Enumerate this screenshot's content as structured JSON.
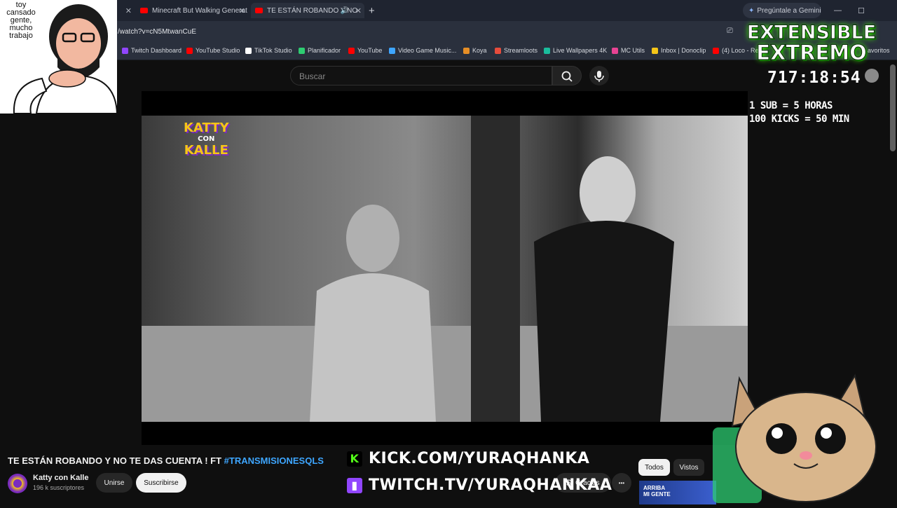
{
  "browser": {
    "tabs": [
      {
        "title": "Minecraft But Walking Generat",
        "close": "✕"
      },
      {
        "title": "TE ESTÁN ROBANDO Y NO",
        "close": "✕"
      }
    ],
    "first_tab_close": "✕",
    "new_tab": "+",
    "gemini_button": "Pregúntale a Gemini",
    "address": "/watch?v=cN5MtwanCuE",
    "bookmarks": [
      {
        "label": "Twitch Dashboard",
        "color": "#9146ff"
      },
      {
        "label": "YouTube Studio",
        "color": "#ff0000"
      },
      {
        "label": "TikTok Studio",
        "color": "#ffffff"
      },
      {
        "label": "Planificador",
        "color": "#2ecc71"
      },
      {
        "label": "YouTube",
        "color": "#ff0000"
      },
      {
        "label": "Video Game Music...",
        "color": "#3ea6ff"
      },
      {
        "label": "Koya",
        "color": "#e58e26"
      },
      {
        "label": "Streamloots",
        "color": "#e74c3c"
      },
      {
        "label": "Live Wallpapers 4K",
        "color": "#1abc9c"
      },
      {
        "label": "MC Utils",
        "color": "#e84393"
      },
      {
        "label": "Inbox | Donoclip",
        "color": "#f5c518"
      },
      {
        "label": "(4) Loco - Re",
        "color": "#ff0000"
      }
    ],
    "bookmarks_overflow": "avoritos"
  },
  "youtube": {
    "search_placeholder": "Buscar",
    "video_title": "TE ESTÁN ROBANDO Y NO TE DAS CUENTA ! FT",
    "video_hashtag": "#TRANSMISIONESQLS",
    "channel_name": "Katty con Kalle",
    "subscribers": "196 k suscriptores",
    "join_label": "Unirse",
    "subscribe_label": "Suscribirse",
    "thanks_label": "Gracias",
    "more_label": "•••",
    "filter_all": "Todos",
    "filter_watched": "Vistos",
    "video_logo_line1": "KATTY",
    "video_logo_line2": "CON",
    "video_logo_line3": "KALLE",
    "thumb_text_1": "ARRIBA",
    "thumb_text_2": "MI GENTE"
  },
  "overlay": {
    "webcam_text": "toy cansado gente, mucho trabajo",
    "brand_line1": "EXTENSIBLE",
    "brand_line2": "EXTREMO",
    "timer": "717:18:54",
    "rule_sub": "1 SUB = 5 HORAS",
    "rule_kicks": "100 KICKS = 50 MIN",
    "kick_url": "KICK.COM/YURAQHANKA",
    "twitch_url": "TWITCH.TV/YURAQHANKAA"
  }
}
